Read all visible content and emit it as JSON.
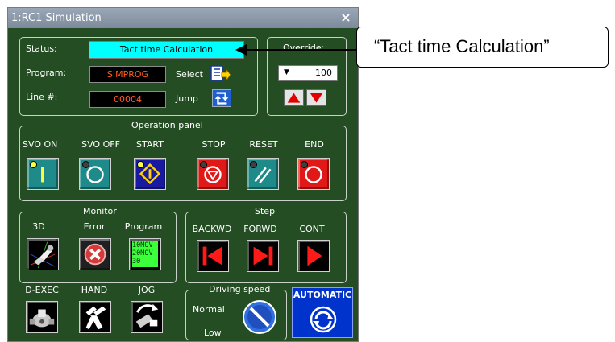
{
  "window": {
    "title": "1:RC1 Simulation",
    "close_glyph": "×"
  },
  "status": {
    "status_label": "Status:",
    "status_value": "Tact time Calculation",
    "program_label": "Program:",
    "program_value": "SIMPROG",
    "select_label": "Select",
    "line_label": "Line #:",
    "line_value": "00004",
    "jump_label": "Jump"
  },
  "override": {
    "label": "Override:",
    "value": "100",
    "arrow": "▼"
  },
  "operation_panel": {
    "title": "Operation panel",
    "buttons": [
      {
        "label": "SVO ON",
        "icon": "servo-on-icon",
        "color": "#1e8a8a"
      },
      {
        "label": "SVO OFF",
        "icon": "servo-off-icon",
        "color": "#1e8a8a"
      },
      {
        "label": "START",
        "icon": "start-icon",
        "color": "#1a1aa0"
      },
      {
        "label": "STOP",
        "icon": "stop-icon",
        "color": "#e01818"
      },
      {
        "label": "RESET",
        "icon": "reset-icon",
        "color": "#1e8a8a"
      },
      {
        "label": "END",
        "icon": "end-icon",
        "color": "#e01818"
      }
    ]
  },
  "monitor": {
    "title": "Monitor",
    "buttons": [
      {
        "label": "3D",
        "icon": "3d-view-icon"
      },
      {
        "label": "Error",
        "icon": "error-icon"
      },
      {
        "label": "Program",
        "icon": "program-monitor-icon",
        "lines": [
          "10MOV",
          "20MOV",
          "30 ····"
        ]
      }
    ]
  },
  "step": {
    "title": "Step",
    "buttons": [
      {
        "label": "BACKWD",
        "icon": "step-backward-icon"
      },
      {
        "label": "FORWD",
        "icon": "step-forward-icon"
      },
      {
        "label": "CONT",
        "icon": "continue-icon"
      }
    ]
  },
  "tools": [
    {
      "label": "D-EXEC",
      "icon": "direct-exec-icon"
    },
    {
      "label": "HAND",
      "icon": "hand-icon"
    },
    {
      "label": "JOG",
      "icon": "jog-icon"
    }
  ],
  "driving_speed": {
    "title": "Driving speed",
    "normal_label": "Normal",
    "low_label": "Low"
  },
  "automatic": {
    "label": "AUTOMATIC"
  },
  "callout": {
    "text": "“Tact time Calculation”"
  },
  "colors": {
    "window_bg": "#244d24",
    "status_bg": "#00ffff",
    "field_text": "#ff5a1e",
    "accent_blue": "#0033cc"
  }
}
